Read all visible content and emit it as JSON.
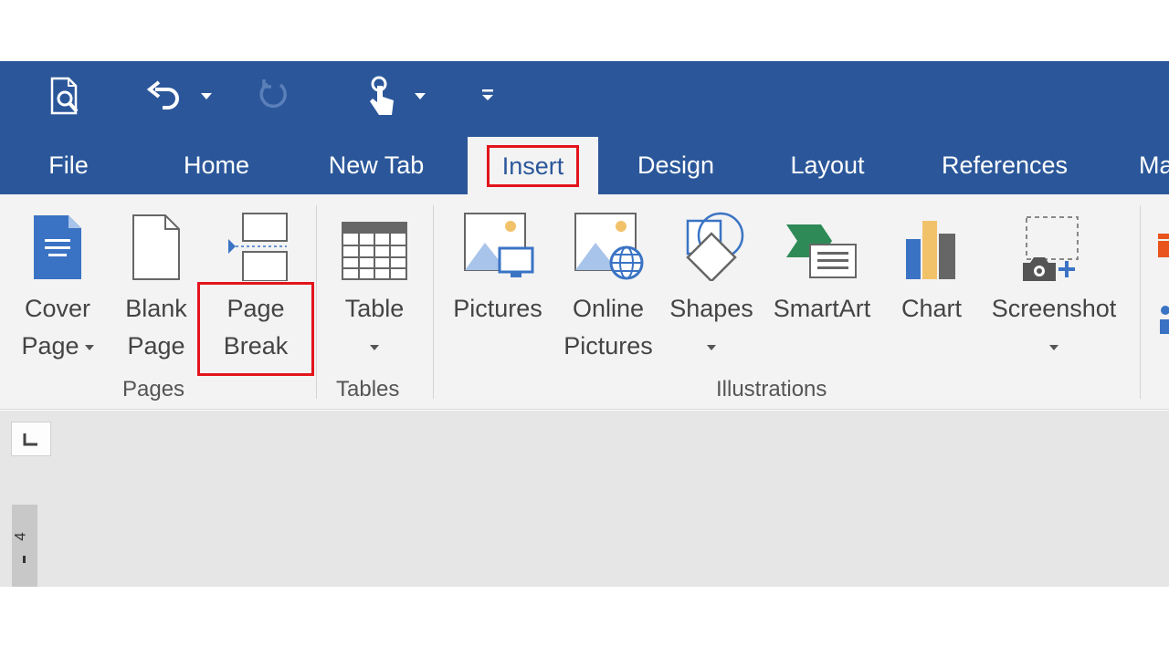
{
  "quick_access": {
    "items": [
      {
        "name": "print-preview-icon"
      },
      {
        "name": "undo-icon"
      },
      {
        "name": "redo-icon"
      },
      {
        "name": "touch-mode-icon"
      },
      {
        "name": "customize-qat-icon"
      }
    ]
  },
  "tabs": [
    {
      "label": "File"
    },
    {
      "label": "Home"
    },
    {
      "label": "New Tab"
    },
    {
      "label": "Insert",
      "active": true
    },
    {
      "label": "Design"
    },
    {
      "label": "Layout"
    },
    {
      "label": "References"
    },
    {
      "label": "Ma"
    }
  ],
  "ribbon": {
    "groups": {
      "pages": "Pages",
      "tables": "Tables",
      "illustrations": "Illustrations"
    },
    "buttons": {
      "cover_page": {
        "line1": "Cover",
        "line2": "Page"
      },
      "blank_page": {
        "line1": "Blank",
        "line2": "Page"
      },
      "page_break": {
        "line1": "Page",
        "line2": "Break"
      },
      "table": {
        "line1": "Table"
      },
      "pictures": {
        "line1": "Pictures"
      },
      "online_pictures": {
        "line1": "Online",
        "line2": "Pictures"
      },
      "shapes": {
        "line1": "Shapes"
      },
      "smartart": {
        "line1": "SmartArt"
      },
      "chart": {
        "line1": "Chart"
      },
      "screenshot": {
        "line1": "Screenshot"
      }
    }
  },
  "ruler": {
    "vertical_number": "4"
  },
  "colors": {
    "title_bar": "#2b579a",
    "ribbon_bg": "#f3f3f3",
    "highlight": "#e3141c",
    "doc_bg": "#e6e6e6"
  }
}
